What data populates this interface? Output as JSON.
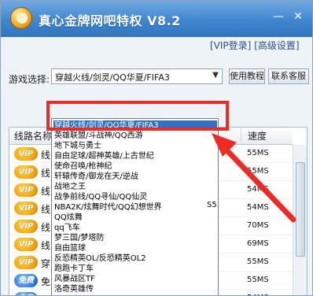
{
  "window": {
    "title": "真心金牌网吧特权 V8.2",
    "minimize_glyph": "—",
    "close_glyph": "✕"
  },
  "links": {
    "vip_login": "[VIP登录]",
    "advanced_settings": "[高级设置]"
  },
  "game_select": {
    "label": "游戏选择:",
    "value": "穿越火线/剑灵/QQ华夏/FIFA3",
    "arrow_glyph": "▼"
  },
  "buttons": {
    "help": "使用教程",
    "service": "联系客服"
  },
  "table": {
    "headers": {
      "name": "线路名称",
      "speed": "速度"
    },
    "rows": [
      {
        "badge": "VIP",
        "name": "线",
        "speed": "55MS"
      },
      {
        "badge": "VIP",
        "name": "线",
        "speed": "55MS"
      },
      {
        "badge": "VIP",
        "name": "线",
        "speed": "54MS"
      },
      {
        "badge": "VIP",
        "name": "线",
        "speed": "54MS"
      },
      {
        "badge": "VIP",
        "name": "线",
        "speed": "70MS"
      },
      {
        "badge": "VIP",
        "name": "线",
        "speed": "69MS"
      },
      {
        "badge": "VIP",
        "name": "穿",
        "speed": "55MS"
      },
      {
        "badge": "免费",
        "name": "免",
        "speed": "55MS"
      },
      {
        "badge": "免费",
        "name": "免",
        "speed": "54MS"
      }
    ]
  },
  "dropdown": {
    "cut_text": "S5",
    "options": [
      "穿越火线/剑灵/QQ华夏/FIFA3",
      "英雄联盟/斗战神/QQ西游",
      "地下城与勇士",
      "自由足球/超神英雄/上古世纪",
      "使命召唤/枪神纪",
      "轩辕传奇/御龙在天/逆战",
      "战地之王",
      "战争前线/QQ寻仙/QQ仙灵",
      "NBA2K/炫舞时代/QQ幻想世界",
      "QQ炫舞",
      "qq飞车",
      "梦三国/梦塔防",
      "自由篮球",
      "反恐精英OL/反恐精英OL2",
      "跑跑卡丁车",
      "风暴战区TF",
      "洛奇英雄传"
    ]
  },
  "colors": {
    "annotation": "#ee2a24",
    "selection": "#3270c8",
    "titlebar": "#3f86cf"
  }
}
